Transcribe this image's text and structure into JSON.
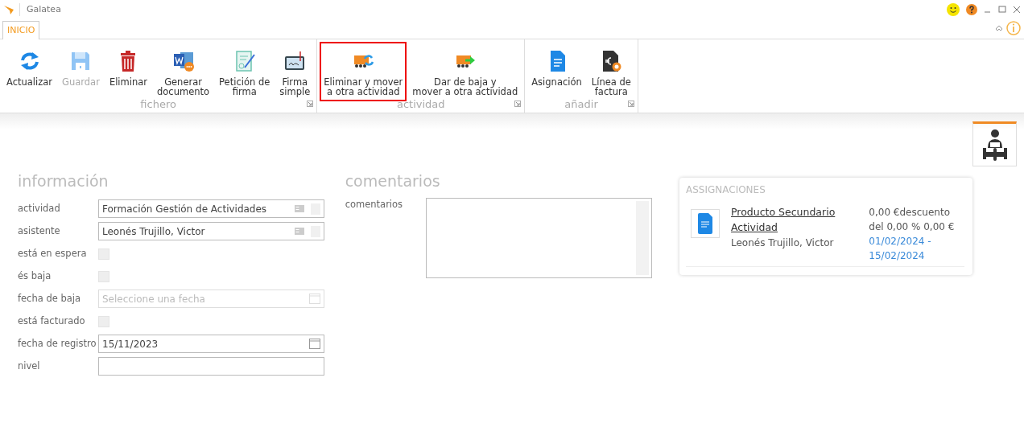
{
  "window": {
    "title": "Galatea"
  },
  "tabs": [
    {
      "label": "INICIO",
      "selected": true
    }
  ],
  "ribbon": {
    "groups": [
      {
        "label": "fichero",
        "buttons": [
          {
            "kind": "refresh",
            "label": "Actualizar",
            "disabled": false,
            "focused": false
          },
          {
            "kind": "save",
            "label": "Guardar",
            "disabled": true,
            "focused": false
          },
          {
            "kind": "trash",
            "label": "Eliminar",
            "disabled": false,
            "focused": false
          },
          {
            "kind": "word",
            "label": "Generar documento",
            "disabled": false,
            "focused": false
          },
          {
            "kind": "certificate",
            "label": "Petición de firma",
            "disabled": false,
            "focused": false
          },
          {
            "kind": "tablet",
            "label": "Firma simple",
            "disabled": false,
            "focused": false
          }
        ]
      },
      {
        "label": "actividad",
        "buttons": [
          {
            "kind": "move",
            "label": "Eliminar y mover a otra actividad",
            "disabled": false,
            "focused": true
          },
          {
            "kind": "transfer",
            "label": "Dar de baja y mover a otra actividad",
            "disabled": false,
            "focused": false
          }
        ]
      },
      {
        "label": "añadir",
        "buttons": [
          {
            "kind": "document",
            "label": "Asignación",
            "disabled": false,
            "focused": false
          },
          {
            "kind": "invoice",
            "label": "Línea de factura",
            "disabled": false,
            "focused": false
          }
        ]
      }
    ]
  },
  "informacion": {
    "title": "información",
    "fields": [
      {
        "kind": "lookup",
        "label": "actividad",
        "value": "Formación Gestión de Actividades"
      },
      {
        "kind": "lookup",
        "label": "asistente",
        "value": "Leonés Trujillo, Victor"
      },
      {
        "kind": "checkbox",
        "label": "está en espera",
        "checked": false
      },
      {
        "kind": "checkbox",
        "label": "és baja",
        "checked": false
      },
      {
        "kind": "date",
        "label": "fecha de baja",
        "placeholder": "Seleccione una fecha",
        "disabled": true
      },
      {
        "kind": "checkbox",
        "label": "está facturado",
        "checked": false
      },
      {
        "kind": "date",
        "label": "fecha de registro",
        "value": "15/11/2023",
        "disabled": false
      },
      {
        "kind": "text",
        "label": "nivel"
      }
    ]
  },
  "comentarios": {
    "title": "comentarios",
    "label": "comentarios"
  },
  "asignaciones": {
    "title": "ASSIGNACIONES",
    "items": [
      {
        "title": "Producto Secundario Actividad",
        "person": "Leonés Trujillo, Victor",
        "amount": "0,00 €descuento del 0,00 % 0,00 €",
        "dates": "01/02/2024 - 15/02/2024"
      }
    ]
  }
}
